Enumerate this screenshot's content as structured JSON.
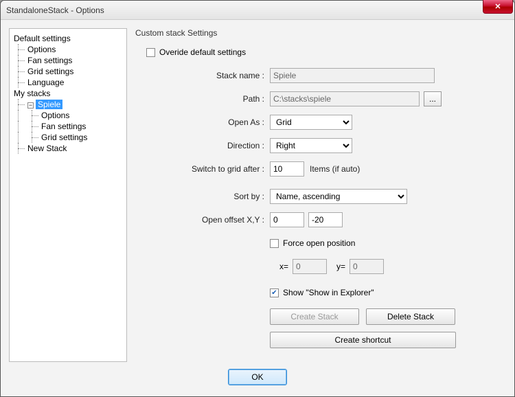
{
  "window": {
    "title": "StandaloneStack - Options"
  },
  "tree": {
    "default_settings": "Default settings",
    "options": "Options",
    "fan_settings": "Fan settings",
    "grid_settings": "Grid settings",
    "language": "Language",
    "my_stacks": "My stacks",
    "spiele": "Spiele",
    "spiele_options": "Options",
    "spiele_fan": "Fan settings",
    "spiele_grid": "Grid settings",
    "new_stack": "New Stack"
  },
  "section": {
    "title": "Custom stack Settings"
  },
  "form": {
    "override_label": "Overide default  settings",
    "override_checked": false,
    "stack_name_label": "Stack name :",
    "stack_name_value": "Spiele",
    "path_label": "Path :",
    "path_value": "C:\\stacks\\spiele",
    "browse_label": "...",
    "open_as_label": "Open As :",
    "open_as_value": "Grid",
    "direction_label": "Direction :",
    "direction_value": "Right",
    "switch_label": "Switch to grid after :",
    "switch_value": "10",
    "switch_after": "Items (if auto)",
    "sort_label": "Sort by :",
    "sort_value": "Name, ascending",
    "offset_label": "Open offset X,Y :",
    "offset_x": "0",
    "offset_y": "-20",
    "force_label": "Force open position",
    "force_checked": false,
    "x_label": "x=",
    "x_value": "0",
    "y_label": "y=",
    "y_value": "0",
    "show_explorer_label": "Show \"Show in Explorer\"",
    "show_explorer_checked": true,
    "create_stack": "Create Stack",
    "delete_stack": "Delete Stack",
    "create_shortcut": "Create shortcut"
  },
  "footer": {
    "ok": "OK"
  }
}
